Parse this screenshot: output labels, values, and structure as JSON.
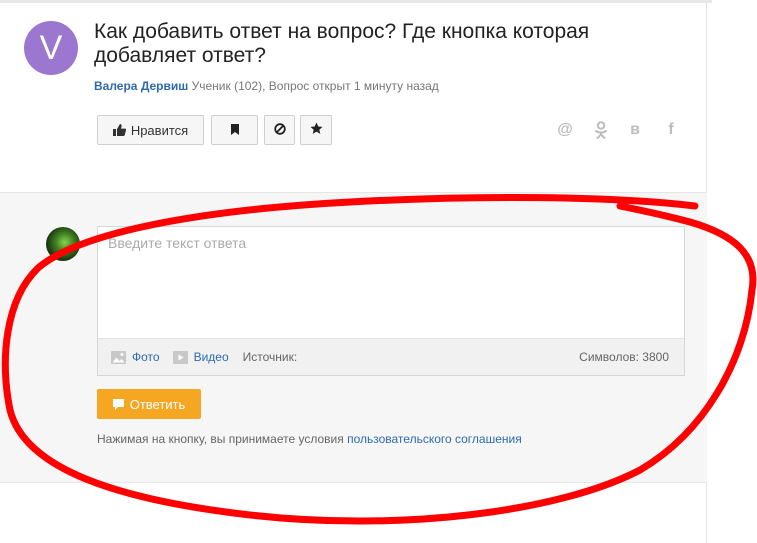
{
  "question": {
    "avatar_letter": "V",
    "title": "Как добавить ответ на вопрос? Где кнопка которая добавляет ответ?",
    "author": "Валера Дервиш",
    "author_meta": "Ученик (102), Вопрос открыт 1 минуту назад"
  },
  "actions": {
    "like_label": "Нравится"
  },
  "social": {
    "at": "@",
    "ok": "ок",
    "vk": "в",
    "fb": "f"
  },
  "answer_form": {
    "placeholder": "Введите текст ответа",
    "photo_label": "Фото",
    "video_label": "Видео",
    "source_label": "Источник:",
    "char_count": "Символов: 3800",
    "submit_label": "Ответить",
    "terms_text": "Нажимая на кнопку, вы принимаете условия",
    "terms_link": "пользовательского соглашения"
  },
  "colors": {
    "accent_blue": "#2d6ab0",
    "submit_orange": "#f5a623",
    "avatar_purple": "#9b77cf",
    "annotation_red": "#ff0000"
  }
}
